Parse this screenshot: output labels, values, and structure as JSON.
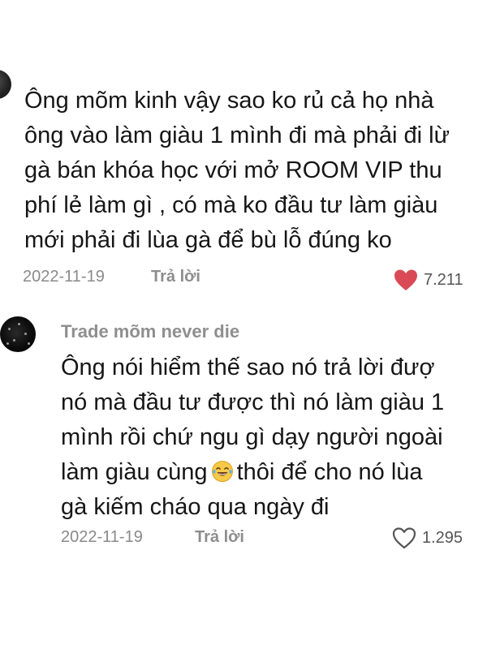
{
  "comments": [
    {
      "username": "",
      "lines": [
        "Ông mõm kinh vậy sao ko rủ cả họ nhà",
        "ông vào làm giàu 1 mình đi mà phải đi lừ",
        "gà bán khóa học với mở ROOM VIP thu",
        "phí lẻ làm gì , có mà ko đầu tư làm giàu",
        "mới phải đi lùa gà để bù lỗ đúng ko"
      ],
      "date": "2022-11-19",
      "reply_label": "Trả lời",
      "likes": "7.211",
      "liked": true
    },
    {
      "username": "Trade mõm never die",
      "lines": [
        "Ông nói hiểm thế sao nó trả lời đượ",
        "nó mà đầu tư được thì nó làm giàu 1",
        "mình rồi chứ ngu gì dạy người ngoài",
        "làm giàu cùng",
        "thôi để cho nó lùa",
        "gà kiếm cháo qua ngày đi"
      ],
      "date": "2022-11-19",
      "reply_label": "Trả lời",
      "likes": "1.295",
      "liked": false
    }
  ],
  "icons": {
    "liked_heart": "heart-filled-icon",
    "unliked_heart": "heart-outline-icon",
    "emoji": "laughing-tears-emoji"
  },
  "colors": {
    "heart_red": "#d94a56",
    "meta_gray": "#8a8a8a",
    "text": "#161616"
  }
}
